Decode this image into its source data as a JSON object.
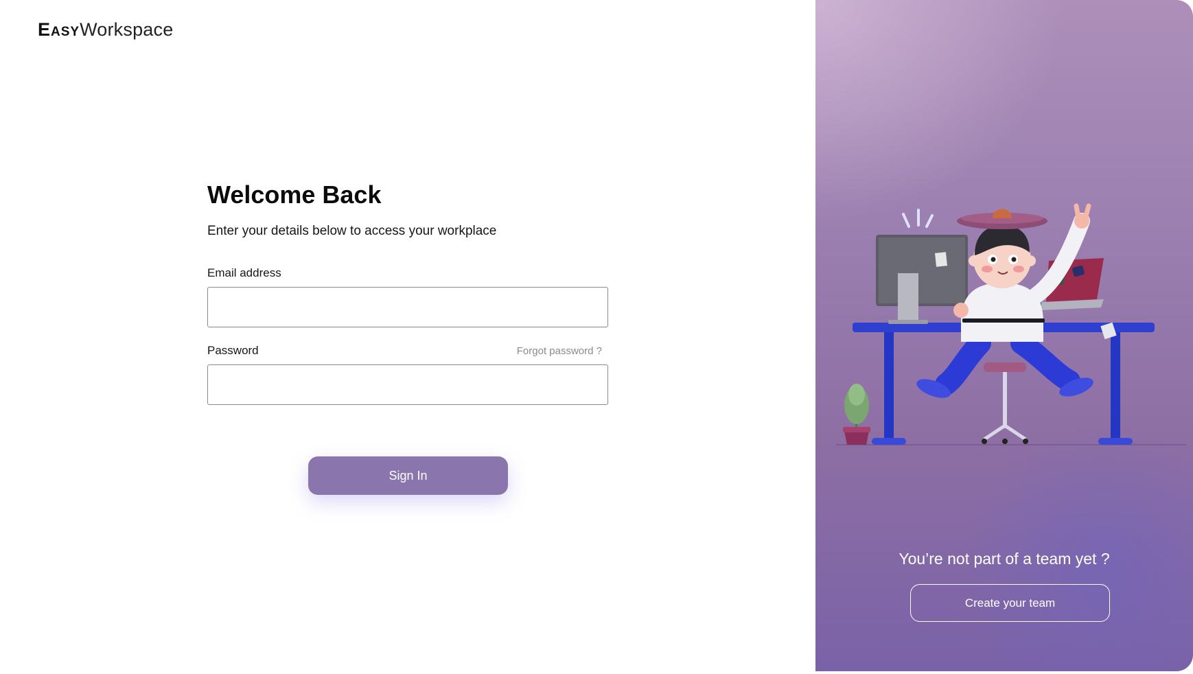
{
  "brand": {
    "logo_bold": "Easy",
    "logo_light": "Workspace"
  },
  "login": {
    "title": "Welcome Back",
    "subtitle": "Enter your details below to access your workplace",
    "email_label": "Email address",
    "email_value": "",
    "password_label": "Password",
    "password_value": "",
    "forgot_link": "Forgot password ?",
    "sign_in_label": "Sign In"
  },
  "aside": {
    "prompt": "You’re not part of a team yet ?",
    "create_team_label": "Create your team"
  },
  "colors": {
    "primary_button": "#8a76ad",
    "panel_top": "#ad8fb9",
    "panel_bottom": "#7a62a8",
    "desk": "#2f3fd0"
  }
}
